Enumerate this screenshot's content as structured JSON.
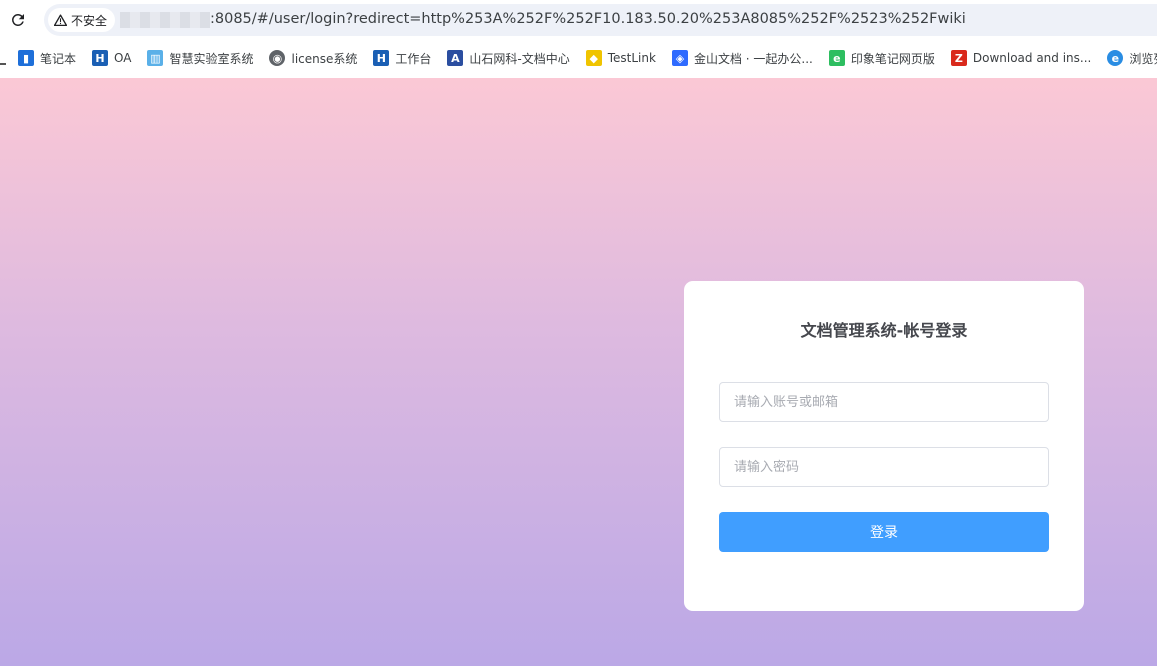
{
  "browser": {
    "security_label": "不安全",
    "url_visible": ":8085/#/user/login?redirect=http%253A%252F%252F10.183.50.20%253A8085%252F%2523%252Fwiki",
    "bookmarks": [
      {
        "label": "笔记本",
        "icon": "notebook-icon",
        "color": "#1e6fd9"
      },
      {
        "label": "OA",
        "icon": "h-logo-icon",
        "color": "#1a5fb4"
      },
      {
        "label": "智慧实验室系统",
        "icon": "cube-icon",
        "color": "#5ab0e8"
      },
      {
        "label": "license系统",
        "icon": "globe-icon",
        "color": "#5f6368"
      },
      {
        "label": "工作台",
        "icon": "h-logo-icon",
        "color": "#1a5fb4"
      },
      {
        "label": "山石网科-文档中心",
        "icon": "document-center-icon",
        "color": "#2b4ea0"
      },
      {
        "label": "TestLink",
        "icon": "testlink-icon",
        "color": "#f0c400"
      },
      {
        "label": "金山文档 · 一起办公...",
        "icon": "kdocs-icon",
        "color": "#2f6bff"
      },
      {
        "label": "印象笔记网页版",
        "icon": "evernote-icon",
        "color": "#2dbe60"
      },
      {
        "label": "Download and ins...",
        "icon": "red-z-icon",
        "color": "#d9291c"
      },
      {
        "label": "浏览列",
        "icon": "browser-e-icon",
        "color": "#2a8de3"
      }
    ]
  },
  "login": {
    "title": "文档管理系统-帐号登录",
    "account_placeholder": "请输入账号或邮箱",
    "password_placeholder": "请输入密码",
    "submit_label": "登录"
  },
  "colors": {
    "primary": "#409eff",
    "gradient_top": "#fbc8d5",
    "gradient_bottom": "#bba8e6"
  }
}
